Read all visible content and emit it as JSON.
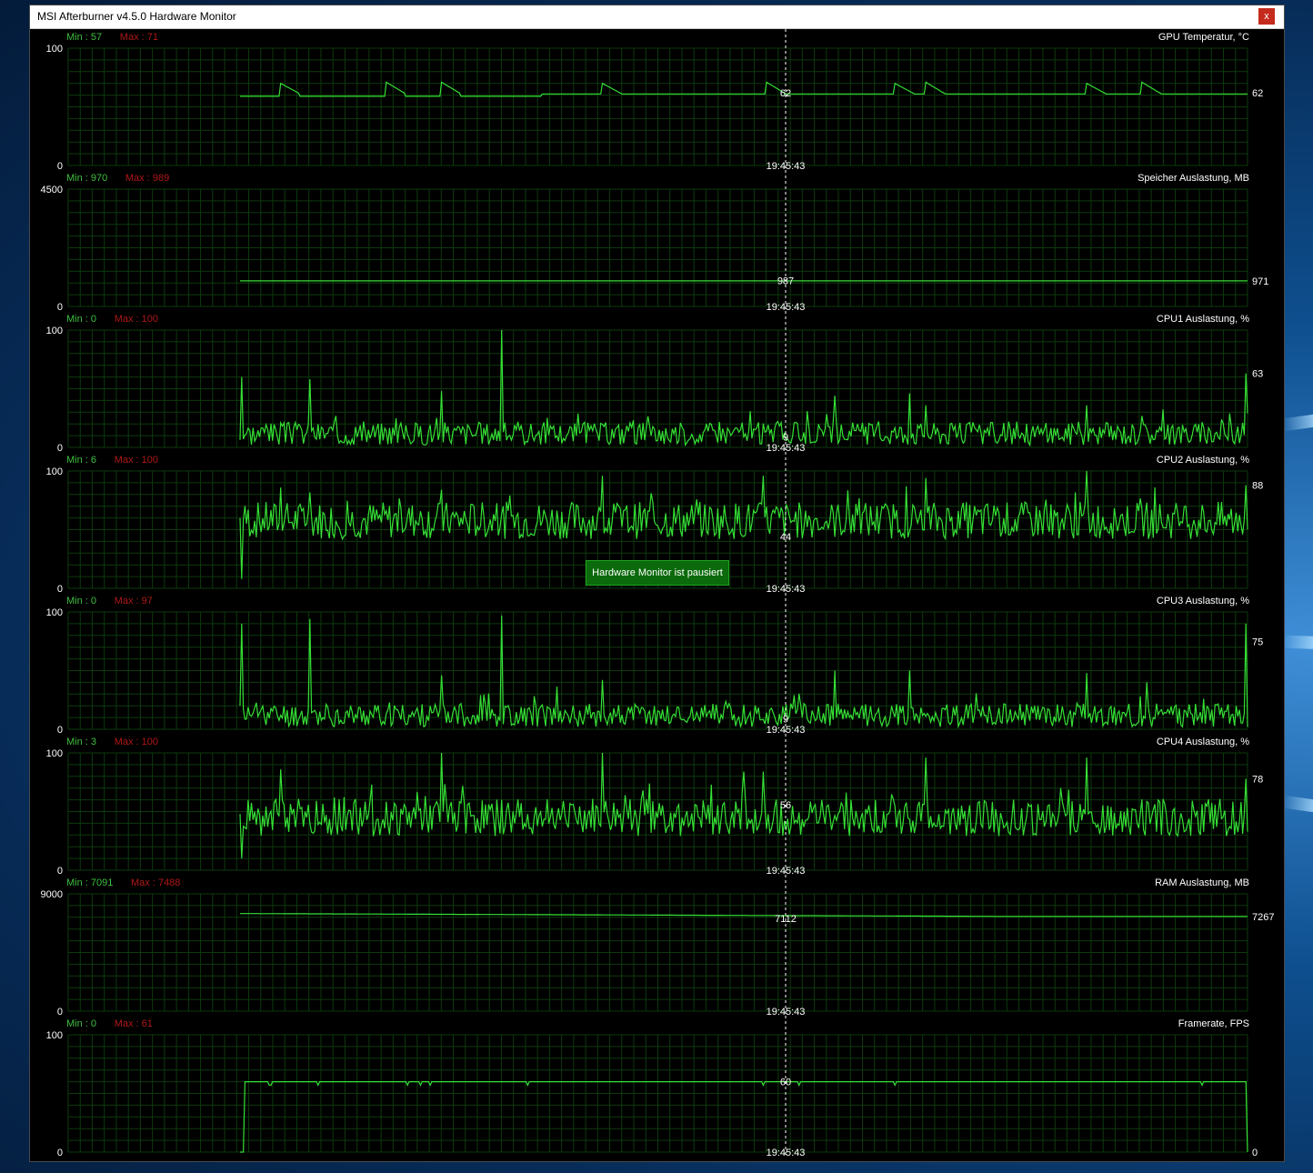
{
  "window": {
    "title": "MSI Afterburner v4.5.0 Hardware Monitor",
    "close_label": "x"
  },
  "paused_badge": "Hardware Monitor ist pausiert",
  "cursor_time": "19:45:43",
  "colors": {
    "line": "#35e035",
    "grid": "#0d3a0d",
    "min_text": "#3fbf3f",
    "max_text": "#b01818",
    "label_text": "#ffffff"
  },
  "chart_data": [
    {
      "type": "line",
      "title": "GPU Temperatur, °C",
      "min_label": "Min : 57",
      "max_label": "Max : 71",
      "y_top": "100",
      "y_bottom": "0",
      "ylim": [
        0,
        100
      ],
      "cursor_value": "62",
      "current_value": "62",
      "pattern": "steady",
      "base": 61,
      "spikes": [
        {
          "x": 0.04,
          "v": 70
        },
        {
          "x": 0.145,
          "v": 71
        },
        {
          "x": 0.2,
          "v": 71
        },
        {
          "x": 0.36,
          "v": 70
        },
        {
          "x": 0.522,
          "v": 71
        },
        {
          "x": 0.65,
          "v": 70
        },
        {
          "x": 0.68,
          "v": 71
        },
        {
          "x": 0.84,
          "v": 70
        },
        {
          "x": 0.895,
          "v": 71
        }
      ],
      "start": 0.0
    },
    {
      "type": "line",
      "title": "Speicher Auslastung, MB",
      "min_label": "Min : 970",
      "max_label": "Max : 989",
      "y_top": "4500",
      "y_bottom": "0",
      "ylim": [
        0,
        4500
      ],
      "cursor_value": "987",
      "current_value": "971",
      "pattern": "flat",
      "base": 980,
      "start": 0.0
    },
    {
      "type": "line",
      "title": "CPU1 Auslastung, %",
      "min_label": "Min : 0",
      "max_label": "Max : 100",
      "y_top": "100",
      "y_bottom": "0",
      "ylim": [
        0,
        100
      ],
      "cursor_value": "9",
      "current_value": "63",
      "pattern": "noisy",
      "base": 12,
      "amp": 10,
      "seed": 3,
      "spikes": [
        {
          "x": 0.002,
          "v": 60
        },
        {
          "x": 0.07,
          "v": 58
        },
        {
          "x": 0.2,
          "v": 48
        },
        {
          "x": 0.26,
          "v": 100
        },
        {
          "x": 0.59,
          "v": 44
        },
        {
          "x": 0.665,
          "v": 46
        },
        {
          "x": 0.68,
          "v": 36
        },
        {
          "x": 0.84,
          "v": 36
        },
        {
          "x": 0.999,
          "v": 63
        }
      ],
      "start": 0.0
    },
    {
      "type": "line",
      "title": "CPU2 Auslastung, %",
      "min_label": "Min : 6",
      "max_label": "Max : 100",
      "y_top": "100",
      "y_bottom": "0",
      "ylim": [
        0,
        100
      ],
      "cursor_value": "44",
      "current_value": "88",
      "pattern": "noisy",
      "base": 58,
      "amp": 16,
      "seed": 7,
      "spikes": [
        {
          "x": 0.001,
          "v": 8
        },
        {
          "x": 0.04,
          "v": 86
        },
        {
          "x": 0.2,
          "v": 84
        },
        {
          "x": 0.36,
          "v": 96
        },
        {
          "x": 0.52,
          "v": 96
        },
        {
          "x": 0.68,
          "v": 94
        },
        {
          "x": 0.84,
          "v": 100
        },
        {
          "x": 0.999,
          "v": 88
        }
      ],
      "start": 0.0
    },
    {
      "type": "line",
      "title": "CPU3 Auslastung, %",
      "min_label": "Min : 0",
      "max_label": "Max : 97",
      "y_top": "100",
      "y_bottom": "0",
      "ylim": [
        0,
        100
      ],
      "cursor_value": "9",
      "current_value": "75",
      "pattern": "noisy",
      "base": 12,
      "amp": 10,
      "seed": 11,
      "spikes": [
        {
          "x": 0.001,
          "v": 90
        },
        {
          "x": 0.07,
          "v": 94
        },
        {
          "x": 0.2,
          "v": 46
        },
        {
          "x": 0.26,
          "v": 97
        },
        {
          "x": 0.36,
          "v": 42
        },
        {
          "x": 0.59,
          "v": 50
        },
        {
          "x": 0.665,
          "v": 50
        },
        {
          "x": 0.84,
          "v": 48
        },
        {
          "x": 0.9,
          "v": 40
        },
        {
          "x": 0.999,
          "v": 90
        }
      ],
      "start": 0.0
    },
    {
      "type": "line",
      "title": "CPU4 Auslastung, %",
      "min_label": "Min : 3",
      "max_label": "Max : 100",
      "y_top": "100",
      "y_bottom": "0",
      "ylim": [
        0,
        100
      ],
      "cursor_value": "56",
      "current_value": "78",
      "pattern": "noisy",
      "base": 45,
      "amp": 16,
      "seed": 19,
      "spikes": [
        {
          "x": 0.001,
          "v": 10
        },
        {
          "x": 0.04,
          "v": 86
        },
        {
          "x": 0.2,
          "v": 100
        },
        {
          "x": 0.36,
          "v": 100
        },
        {
          "x": 0.5,
          "v": 84
        },
        {
          "x": 0.52,
          "v": 84
        },
        {
          "x": 0.68,
          "v": 96
        },
        {
          "x": 0.84,
          "v": 96
        },
        {
          "x": 0.999,
          "v": 78
        }
      ],
      "start": 0.0
    },
    {
      "type": "line",
      "title": "RAM Auslastung, MB",
      "min_label": "Min : 7091",
      "max_label": "Max : 7488",
      "y_top": "9000",
      "y_bottom": "0",
      "ylim": [
        0,
        9000
      ],
      "cursor_value": "7112",
      "current_value": "7267",
      "pattern": "ramp",
      "from": 7488,
      "to": 7267,
      "start": 0.0
    },
    {
      "type": "line",
      "title": "Framerate, FPS",
      "min_label": "Min : 0",
      "max_label": "Max : 61",
      "y_top": "100",
      "y_bottom": "0",
      "ylim": [
        0,
        100
      ],
      "cursor_value": "60",
      "current_value": "0",
      "pattern": "fps",
      "base": 60,
      "start": 0.004
    }
  ]
}
